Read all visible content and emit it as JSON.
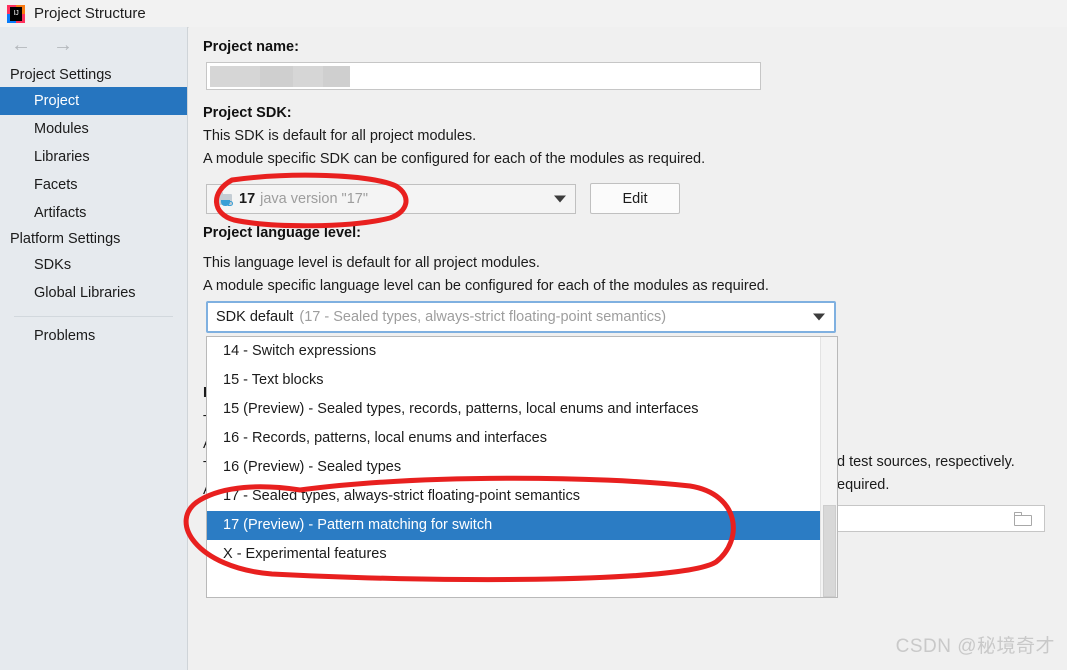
{
  "window": {
    "title": "Project Structure",
    "app_icon": "intellij-idea-icon"
  },
  "nav": {
    "back_icon": "arrow-left-icon",
    "forward_icon": "arrow-right-icon"
  },
  "sidebar": {
    "groups": [
      {
        "label": "Project Settings",
        "items": [
          {
            "label": "Project",
            "selected": true
          },
          {
            "label": "Modules",
            "selected": false
          },
          {
            "label": "Libraries",
            "selected": false
          },
          {
            "label": "Facets",
            "selected": false
          },
          {
            "label": "Artifacts",
            "selected": false
          }
        ]
      },
      {
        "label": "Platform Settings",
        "items": [
          {
            "label": "SDKs",
            "selected": false
          },
          {
            "label": "Global Libraries",
            "selected": false
          }
        ]
      }
    ],
    "problems_label": "Problems"
  },
  "main": {
    "project_name": {
      "label": "Project name:",
      "value": "",
      "redacted": true
    },
    "project_sdk": {
      "label": "Project SDK:",
      "desc_line1": "This SDK is default for all project modules.",
      "desc_line2": "A module specific SDK can be configured for each of the modules as required.",
      "selected_name": "17",
      "selected_detail": "java version \"17\"",
      "icon": "jdk-folder-icon",
      "edit_button": "Edit"
    },
    "language_level": {
      "label": "Project language level:",
      "desc_line1": "This language level is default for all project modules.",
      "desc_line2": "A module specific language level can be configured for each of the modules as required.",
      "selected_name": "SDK default",
      "selected_detail": "(17 - Sealed types, always-strict floating-point semantics)",
      "options": [
        {
          "label": "14 - Switch expressions",
          "selected": false
        },
        {
          "label": "15 - Text blocks",
          "selected": false
        },
        {
          "label": "15 (Preview) - Sealed types, records, patterns, local enums and interfaces",
          "selected": false
        },
        {
          "label": "16 - Records, patterns, local enums and interfaces",
          "selected": false
        },
        {
          "label": "16 (Preview) - Sealed types",
          "selected": false
        },
        {
          "label": "17 - Sealed types, always-strict floating-point semantics",
          "selected": false
        },
        {
          "label": "17 (Preview) - Pattern matching for switch",
          "selected": true
        },
        {
          "label": "X - Experimental features",
          "selected": false
        }
      ]
    },
    "compiler_output": {
      "fragment_label": "P",
      "fragment_lines": [
        "T",
        "A",
        "T",
        "A"
      ],
      "tail_line1": "d test sources, respectively.",
      "tail_line2": "equired.",
      "path_value": "",
      "browse_icon": "folder-browse-icon"
    }
  },
  "annotations": {
    "sdk_circle": "red-ellipse-highlight",
    "options_circle": "red-ellipse-highlight",
    "color": "#e8201f"
  },
  "watermark": "CSDN @秘境奇才"
}
